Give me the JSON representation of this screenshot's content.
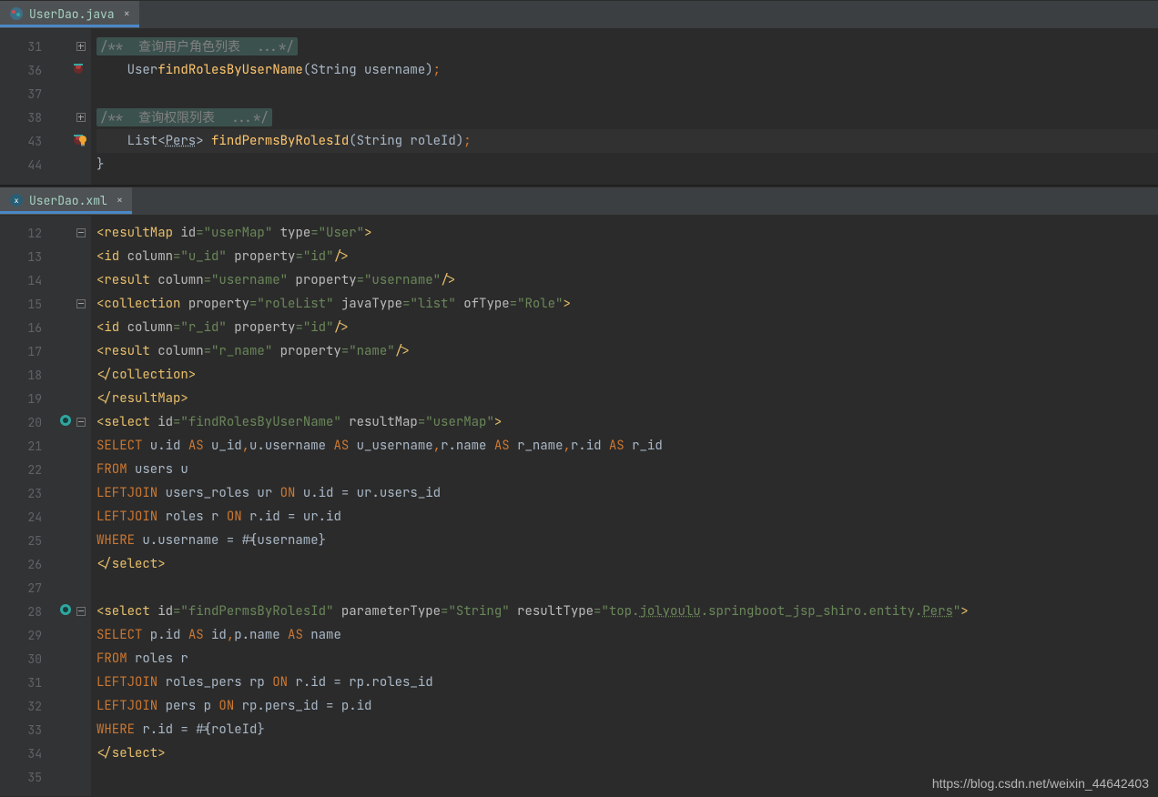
{
  "top": {
    "tab": "UserDao.java",
    "lines": {
      "l31": {
        "num": "31",
        "doc": "/**  查询用户角色列表  ...*/"
      },
      "l36": {
        "num": "36",
        "prefix": "    ",
        "ret": "User",
        "method": "findRolesByUserName",
        "params": "(String username)",
        "semi": ";"
      },
      "l37": {
        "num": "37"
      },
      "l38": {
        "num": "38",
        "doc": "/**  查询权限列表  ...*/"
      },
      "l43": {
        "num": "43",
        "prefix": "    ",
        "ret1": "List<",
        "generic": "Pers",
        "ret2": "> ",
        "method": "findPermsByRolesId",
        "params": "(String roleId)",
        "semi": ";"
      },
      "l44": {
        "num": "44",
        "brace": "}"
      }
    }
  },
  "bottom": {
    "tab": "UserDao.xml",
    "lines": {
      "l12": {
        "num": "12"
      },
      "l13": {
        "num": "13"
      },
      "l14": {
        "num": "14"
      },
      "l15": {
        "num": "15"
      },
      "l16": {
        "num": "16"
      },
      "l17": {
        "num": "17"
      },
      "l18": {
        "num": "18"
      },
      "l19": {
        "num": "19"
      },
      "l20": {
        "num": "20"
      },
      "l21": {
        "num": "21"
      },
      "l22": {
        "num": "22"
      },
      "l23": {
        "num": "23"
      },
      "l24": {
        "num": "24"
      },
      "l25": {
        "num": "25"
      },
      "l26": {
        "num": "26"
      },
      "l27": {
        "num": "27"
      },
      "l28": {
        "num": "28"
      },
      "l29": {
        "num": "29"
      },
      "l30": {
        "num": "30"
      },
      "l31": {
        "num": "31"
      },
      "l32": {
        "num": "32"
      },
      "l33": {
        "num": "33"
      },
      "l34": {
        "num": "34"
      },
      "l35": {
        "num": "35"
      }
    },
    "x": {
      "rm_open": "<resultMap ",
      "id": "id",
      "eq": "=",
      "userMap": "\"userMap\"",
      "sp": " ",
      "type": "type",
      "user": "\"User\"",
      "gt": ">",
      "id_open": "<id ",
      "column": "column",
      "u_id": "\"u_id\"",
      "property": "property",
      "idv": "\"id\"",
      "slashgt": "/>",
      "result_open": "<result ",
      "username": "\"username\"",
      "usernameP": "\"username\"",
      "coll_open": "<collection ",
      "roleList": "\"roleList\"",
      "javaType": "javaType",
      "list": "\"list\"",
      "ofType": "ofType",
      "role": "\"Role\"",
      "r_id": "\"r_id\"",
      "r_name": "\"r_name\"",
      "name": "\"name\"",
      "coll_close": "</collection>",
      "rm_close": "</resultMap>",
      "sel_open": "<select ",
      "findRoles": "\"findRolesByUserName\"",
      "resultMap": "resultMap",
      "SELECT": "SELECT",
      "u_id_as": " u.id ",
      "AS": "AS",
      "u_id_txt": " u_id",
      "comma": ",",
      "u_username": "u.username ",
      "u_username_txt": " u_username",
      "r_name_as": "r.name ",
      "r_name_txt": " r_name",
      "r_id_as": "r.id ",
      "r_id_txt": " r_id",
      "FROM": "FROM",
      "users_u": " users u",
      "LEFT": "LEFT",
      "JOIN": "JOIN",
      "users_roles": " users_roles ur ",
      "ON": "ON",
      "on1": " u.id = ur.users_id",
      "roles_r": " roles r ",
      "on2": " r.id = ur.id",
      "WHERE": "WHERE",
      "where1": " u.username = #{username}",
      "sel_close": "</select>",
      "findPerms": "\"findPermsByRolesId\"",
      "parameterType": "parameterType",
      "string": "\"String\"",
      "resultType": "resultType",
      "restype_pre": "\"top.",
      "jolyoulu": "jolyoulu",
      "restype_mid": ".springboot_jsp_shiro.entity.",
      "pers": "Pers",
      "restype_end": "\"",
      "p_id_as": " p.id ",
      "id_txt": " id",
      "p_name_as": "p.name ",
      "name_txt": " name",
      "roles_r2": " roles r",
      "roles_pers": " roles_pers rp ",
      "on3": " r.id = rp.roles_id",
      "pers_p": " pers p ",
      "on4": " rp.pers_id = p.id",
      "where2": " r.id = #{roleId}"
    }
  },
  "watermark": "https://blog.csdn.net/weixin_44642403"
}
